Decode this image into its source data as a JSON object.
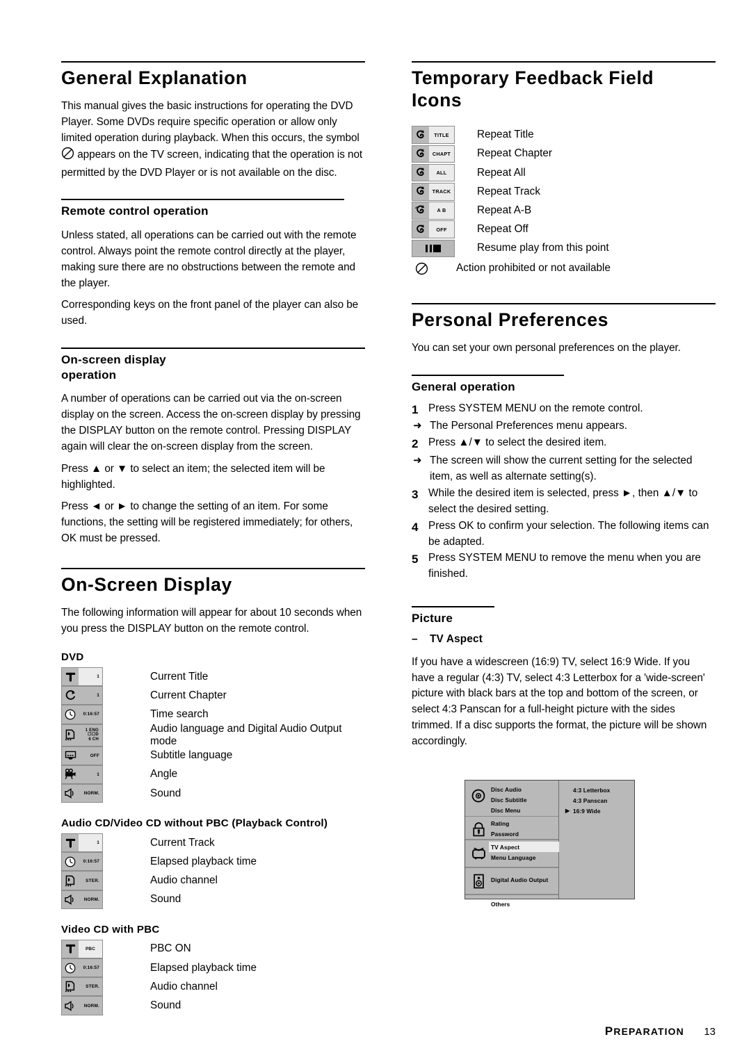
{
  "left_column": {
    "general_explanation": {
      "heading": "General Explanation",
      "para_before_symbol": "This manual gives the basic instructions for operating the DVD Player. Some DVDs require specific operation or allow only limited operation during playback. When this occurs, the symbol",
      "para_after_symbol": "appears on the TV screen, indicating that the operation is not permitted by the DVD Player or is not available on the disc.",
      "symbol_icon": "prohibited-icon"
    },
    "remote_control": {
      "heading": "Remote control operation",
      "para1": "Unless stated, all operations can be carried out with the remote control. Always point the remote control directly at the player, making sure there are no obstructions between the remote and the player.",
      "para2": "Corresponding keys on the front panel of the player can also be used."
    },
    "onscreen_display_operation": {
      "heading": "On-screen display operation",
      "para1": "A number of operations can be carried out via the on-screen display on the screen. Access the on-screen display by pressing the DISPLAY button on the remote control. Pressing DISPLAY again will clear the on-screen display from the screen.",
      "para2": "Press ▲ or ▼ to select an item; the selected item will be highlighted.",
      "para3": "Press ◄ or ► to change the setting of an item. For some functions, the setting will be registered immediately; for others, OK must be pressed."
    },
    "onscreen_display": {
      "heading": "On-Screen Display",
      "intro": "The following information will appear for about 10 seconds when you press the DISPLAY button on the remote control.",
      "dvd": {
        "title": "DVD",
        "rows": [
          {
            "icon": "title-t-icon",
            "value": "1",
            "highlight": true,
            "label": "Current Title"
          },
          {
            "icon": "chapter-c-icon",
            "value": "1",
            "highlight": false,
            "label": "Current Chapter"
          },
          {
            "icon": "clock-icon",
            "value": "0:16:57",
            "highlight": false,
            "label": "Time search"
          },
          {
            "icon": "audio-language-icon",
            "value_lines": [
              "1  ENG",
              "☐☐D",
              "6 CH"
            ],
            "highlight": false,
            "label": "Audio language and Digital Audio Output mode"
          },
          {
            "icon": "subtitle-icon",
            "value": "OFF",
            "highlight": false,
            "label": "Subtitle language"
          },
          {
            "icon": "camera-angle-icon",
            "value": "1",
            "highlight": false,
            "label": "Angle"
          },
          {
            "icon": "speaker-icon",
            "value": "NORM.",
            "highlight": false,
            "label": "Sound"
          }
        ]
      },
      "audio_cd": {
        "title": "Audio CD/Video CD without PBC (Playback Control)",
        "rows": [
          {
            "icon": "title-t-icon",
            "value": "1",
            "highlight": true,
            "label": "Current Track"
          },
          {
            "icon": "clock-icon",
            "value": "0:16:57",
            "highlight": false,
            "label": "Elapsed playback time"
          },
          {
            "icon": "audio-language-icon",
            "value": "STER.",
            "highlight": false,
            "label": "Audio channel"
          },
          {
            "icon": "speaker-icon",
            "value": "NORM.",
            "highlight": false,
            "label": "Sound"
          }
        ]
      },
      "video_cd_pbc": {
        "title": "Video CD with PBC",
        "rows": [
          {
            "icon": "title-t-icon",
            "value": "PBC",
            "highlight": true,
            "label": "PBC ON"
          },
          {
            "icon": "clock-icon",
            "value": "0:16:57",
            "highlight": false,
            "label": "Elapsed playback time"
          },
          {
            "icon": "audio-language-icon",
            "value": "STER.",
            "highlight": false,
            "label": "Audio channel"
          },
          {
            "icon": "speaker-icon",
            "value": "NORM.",
            "highlight": false,
            "label": "Sound"
          }
        ]
      }
    }
  },
  "right_column": {
    "feedback_icons": {
      "heading": "Temporary Feedback Field Icons",
      "rows": [
        {
          "icon": "repeat-icon",
          "value": "TITLE",
          "label": "Repeat Title"
        },
        {
          "icon": "repeat-icon",
          "value": "CHAPT",
          "label": "Repeat Chapter"
        },
        {
          "icon": "repeat-icon",
          "value": "ALL",
          "label": "Repeat All"
        },
        {
          "icon": "repeat-icon",
          "value": "TRACK",
          "label": "Repeat Track"
        },
        {
          "icon": "repeat-ab-icon",
          "value": "A  B",
          "label": "Repeat A-B"
        },
        {
          "icon": "repeat-icon",
          "value": "OFF",
          "label": "Repeat Off"
        }
      ],
      "resume": {
        "icon": "resume-play-icon",
        "label": "Resume play from this point"
      },
      "prohibited": {
        "icon": "prohibited-icon",
        "label": "Action prohibited or not available"
      }
    },
    "personal_preferences": {
      "heading": "Personal Preferences",
      "intro": "You can set your own personal preferences on the player.",
      "general_operation": {
        "heading": "General operation",
        "steps": [
          {
            "num": "1",
            "text": "Press SYSTEM MENU on the remote control.",
            "arrow": "The Personal Preferences menu appears."
          },
          {
            "num": "2",
            "text": "Press ▲/▼ to select the desired item.",
            "arrow": "The screen will show the current setting for the selected item, as well as alternate setting(s)."
          },
          {
            "num": "3",
            "text": "While the desired item is selected, press ►, then ▲/▼ to select the desired setting.",
            "arrow": ""
          },
          {
            "num": "4",
            "text": "Press OK to confirm your selection. The following items can be adapted.",
            "arrow": ""
          },
          {
            "num": "5",
            "text": "Press SYSTEM MENU to remove the menu when you are finished.",
            "arrow": ""
          }
        ]
      },
      "picture": {
        "heading": "Picture",
        "dash": "–",
        "subheading": "TV Aspect",
        "body": "If you have a widescreen (16:9) TV, select 16:9 Wide. If you have a regular (4:3) TV, select 4:3 Letterbox for a 'wide-screen' picture with black bars at the top and bottom of the screen, or select 4:3 Panscan for a full-height picture with the sides trimmed. If a disc supports the format, the picture will be shown accordingly."
      }
    },
    "tv_menu": {
      "groups": [
        {
          "icon": "disc-icon",
          "items": [
            "Disc Audio",
            "Disc Subtitle",
            "Disc Menu"
          ]
        },
        {
          "icon": "lock-icon",
          "items": [
            "Rating",
            "Password"
          ]
        },
        {
          "icon": "tv-icon",
          "items": [
            "TV Aspect",
            "Menu Language"
          ],
          "selected": "TV Aspect"
        },
        {
          "icon": "digital-audio-output-icon",
          "items": [
            "Digital Audio Output"
          ]
        },
        {
          "icon": "",
          "items": [
            "Others"
          ]
        }
      ],
      "options": [
        {
          "label": "4:3 Letterbox",
          "current": false
        },
        {
          "label": "4:3 Panscan",
          "current": false
        },
        {
          "label": "16:9 Wide",
          "current": true
        }
      ]
    }
  },
  "footer": {
    "section_first": "P",
    "section_rest": "REPARATION",
    "page_number": "13"
  },
  "colors": {
    "chip_bg": "#b9b9b9",
    "chip_value_bg": "#ececec",
    "chip_border": "#8d8d8d",
    "menu_bg": "#b9b9b9",
    "menu_border": "#4a4a4a"
  }
}
